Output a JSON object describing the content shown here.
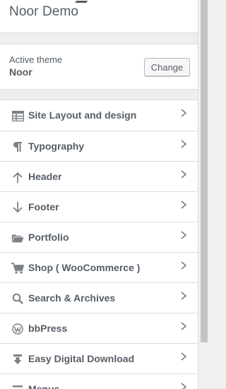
{
  "header": {
    "title": "Noor Demo"
  },
  "theme": {
    "label": "Active theme",
    "name": "Noor",
    "change_label": "Change"
  },
  "menu": {
    "items": [
      {
        "label": "Site Layout and design",
        "icon": "table-icon"
      },
      {
        "label": "Typography",
        "icon": "paragraph-icon"
      },
      {
        "label": "Header",
        "icon": "arrow-up-icon"
      },
      {
        "label": "Footer",
        "icon": "arrow-down-icon"
      },
      {
        "label": "Portfolio",
        "icon": "folder-open-icon"
      },
      {
        "label": "Shop ( WooCommerce )",
        "icon": "cart-icon"
      },
      {
        "label": "Search & Archives",
        "icon": "search-icon"
      },
      {
        "label": "bbPress",
        "icon": "wordpress-icon"
      },
      {
        "label": "Easy Digital Download",
        "icon": "download-icon"
      },
      {
        "label": "Menus",
        "icon": "menu-icon"
      }
    ]
  },
  "colors": {
    "text": "#555d66",
    "separator": "#dcdcde",
    "gap_background": "#eeeeee"
  }
}
